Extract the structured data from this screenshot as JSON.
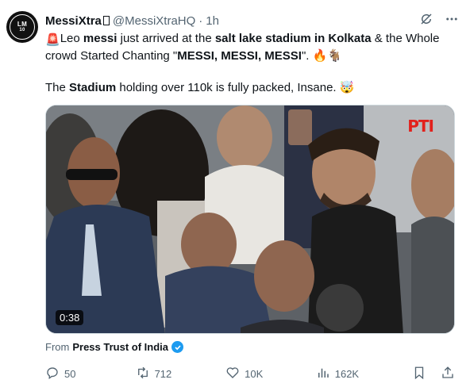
{
  "author": {
    "display_name": "MessiXtra",
    "handle": "@MessiXtraHQ",
    "separator": "·",
    "time": "1h",
    "avatar_text": [
      "MESSI",
      "LM",
      "10",
      "XTRA"
    ]
  },
  "tweet": {
    "line1_parts": [
      {
        "text": "🚨",
        "bold": false
      },
      {
        "text": "Leo ",
        "bold": false
      },
      {
        "text": "messi",
        "bold": true
      },
      {
        "text": " just arrived at the ",
        "bold": false
      },
      {
        "text": "salt lake stadium in Kolkata",
        "bold": true
      },
      {
        "text": " & the Whole crowd Started Chanting \"",
        "bold": false
      },
      {
        "text": "MESSI, MESSI, MESSI",
        "bold": true
      },
      {
        "text": "\". 🔥🐐",
        "bold": false
      }
    ],
    "line2_parts": [
      {
        "text": "The ",
        "bold": false
      },
      {
        "text": "Stadium",
        "bold": true
      },
      {
        "text": " holding over 110k is fully packed, Insane. 🤯",
        "bold": false
      }
    ]
  },
  "media": {
    "duration": "0:38",
    "watermark": "PTI"
  },
  "source": {
    "prefix": "From",
    "name": "Press Trust of India"
  },
  "actions": {
    "replies": "50",
    "reposts": "712",
    "likes": "10K",
    "views": "162K"
  },
  "icons": {
    "grok": "grok-icon",
    "more": "more-icon",
    "reply": "reply-icon",
    "repost": "repost-icon",
    "like": "heart-icon",
    "views": "views-icon",
    "bookmark": "bookmark-icon",
    "share": "share-icon"
  },
  "colors": {
    "text": "#0f1419",
    "secondary": "#536471",
    "verified": "#1d9bf0",
    "watermark": "#e2211c"
  }
}
